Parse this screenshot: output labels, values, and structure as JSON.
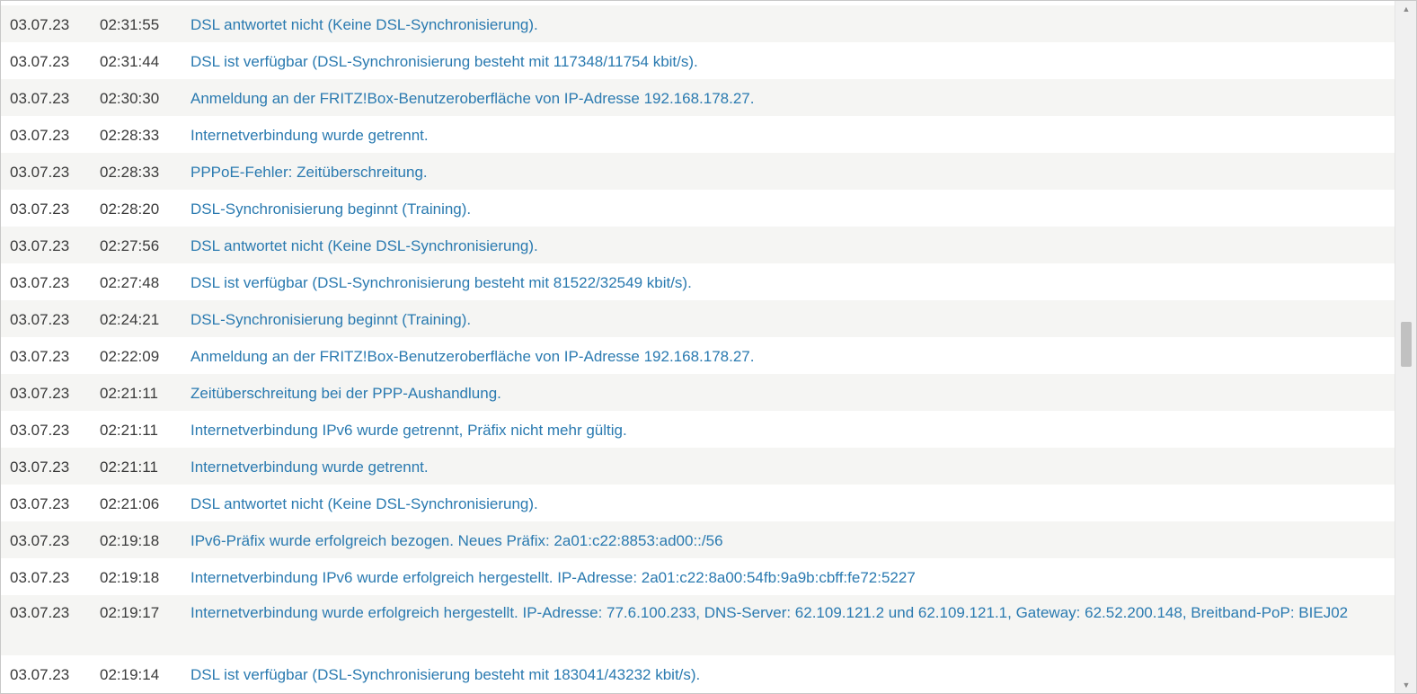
{
  "events": [
    {
      "date": "03.07.23",
      "time": "02:31:55",
      "message": "DSL antwortet nicht (Keine DSL-Synchronisierung)."
    },
    {
      "date": "03.07.23",
      "time": "02:31:44",
      "message": "DSL ist verfügbar (DSL-Synchronisierung besteht mit 117348/11754 kbit/s)."
    },
    {
      "date": "03.07.23",
      "time": "02:30:30",
      "message": "Anmeldung an der FRITZ!Box-Benutzeroberfläche von IP-Adresse 192.168.178.27."
    },
    {
      "date": "03.07.23",
      "time": "02:28:33",
      "message": "Internetverbindung wurde getrennt."
    },
    {
      "date": "03.07.23",
      "time": "02:28:33",
      "message": "PPPoE-Fehler: Zeitüberschreitung."
    },
    {
      "date": "03.07.23",
      "time": "02:28:20",
      "message": "DSL-Synchronisierung beginnt (Training)."
    },
    {
      "date": "03.07.23",
      "time": "02:27:56",
      "message": "DSL antwortet nicht (Keine DSL-Synchronisierung)."
    },
    {
      "date": "03.07.23",
      "time": "02:27:48",
      "message": "DSL ist verfügbar (DSL-Synchronisierung besteht mit 81522/32549 kbit/s)."
    },
    {
      "date": "03.07.23",
      "time": "02:24:21",
      "message": "DSL-Synchronisierung beginnt (Training)."
    },
    {
      "date": "03.07.23",
      "time": "02:22:09",
      "message": "Anmeldung an der FRITZ!Box-Benutzeroberfläche von IP-Adresse 192.168.178.27."
    },
    {
      "date": "03.07.23",
      "time": "02:21:11",
      "message": "Zeitüberschreitung bei der PPP-Aushandlung."
    },
    {
      "date": "03.07.23",
      "time": "02:21:11",
      "message": "Internetverbindung IPv6 wurde getrennt, Präfix nicht mehr gültig."
    },
    {
      "date": "03.07.23",
      "time": "02:21:11",
      "message": "Internetverbindung wurde getrennt."
    },
    {
      "date": "03.07.23",
      "time": "02:21:06",
      "message": "DSL antwortet nicht (Keine DSL-Synchronisierung)."
    },
    {
      "date": "03.07.23",
      "time": "02:19:18",
      "message": "IPv6-Präfix wurde erfolgreich bezogen. Neues Präfix: 2a01:c22:8853:ad00::/56"
    },
    {
      "date": "03.07.23",
      "time": "02:19:18",
      "message": "Internetverbindung IPv6 wurde erfolgreich hergestellt. IP-Adresse: 2a01:c22:8a00:54fb:9a9b:cbff:fe72:5227"
    },
    {
      "date": "03.07.23",
      "time": "02:19:17",
      "message": "Internetverbindung wurde erfolgreich hergestellt. IP-Adresse: 77.6.100.233, DNS-Server: 62.109.121.2 und 62.109.121.1, Gateway: 62.52.200.148, Breitband-PoP: BIEJ02"
    },
    {
      "date": "03.07.23",
      "time": "02:19:14",
      "message": "DSL ist verfügbar (DSL-Synchronisierung besteht mit 183041/43232 kbit/s)."
    }
  ],
  "colors": {
    "message": "#2a7ab0",
    "text": "#3a3a3a",
    "row_alt": "#f5f5f3"
  },
  "scrollbar": {
    "up_icon": "triangle-up-icon",
    "down_icon": "triangle-down-icon"
  }
}
